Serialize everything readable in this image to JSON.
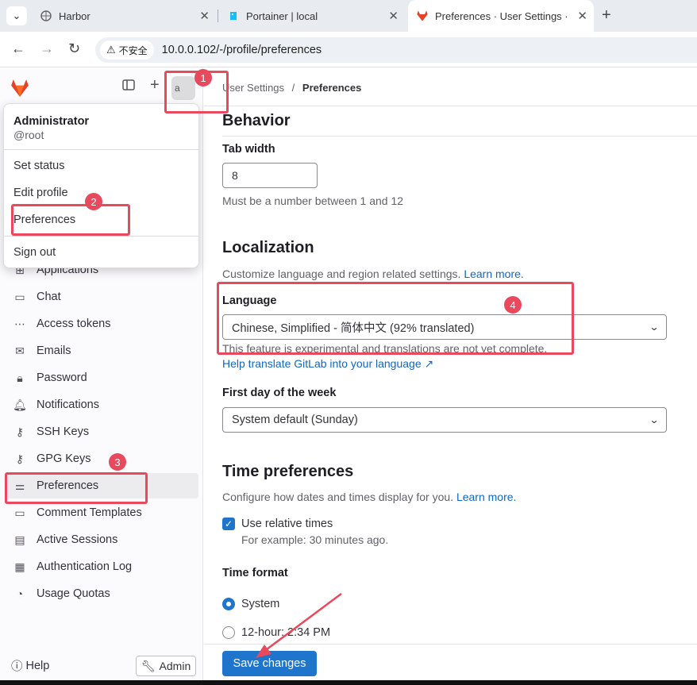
{
  "browser": {
    "tabs": [
      {
        "title": "Harbor"
      },
      {
        "title": "Portainer | local"
      },
      {
        "title": "Preferences · User Settings · "
      }
    ],
    "security_label": "不安全",
    "url": "10.0.0.102/-/profile/preferences"
  },
  "avatar_alt": "a",
  "user_menu": {
    "name": "Administrator",
    "handle": "@root",
    "items": [
      "Set status",
      "Edit profile",
      "Preferences",
      "Sign out"
    ]
  },
  "sidebar": {
    "items": [
      {
        "label": "Applications",
        "icon": "applications-icon"
      },
      {
        "label": "Chat",
        "icon": "chat-icon"
      },
      {
        "label": "Access tokens",
        "icon": "token-icon"
      },
      {
        "label": "Emails",
        "icon": "mail-icon"
      },
      {
        "label": "Password",
        "icon": "lock-icon"
      },
      {
        "label": "Notifications",
        "icon": "bell-icon"
      },
      {
        "label": "SSH Keys",
        "icon": "key-icon"
      },
      {
        "label": "GPG Keys",
        "icon": "key-icon"
      },
      {
        "label": "Preferences",
        "icon": "preferences-icon"
      },
      {
        "label": "Comment Templates",
        "icon": "comment-icon"
      },
      {
        "label": "Active Sessions",
        "icon": "monitor-icon"
      },
      {
        "label": "Authentication Log",
        "icon": "log-icon"
      },
      {
        "label": "Usage Quotas",
        "icon": "quota-icon"
      }
    ],
    "help": "Help",
    "admin": "Admin"
  },
  "breadcrumb": {
    "parent": "User Settings",
    "sep": "/",
    "current": "Preferences"
  },
  "behavior": {
    "title": "Behavior",
    "tab_width_label": "Tab width",
    "tab_width_value": "8",
    "tab_width_help": "Must be a number between 1 and 12"
  },
  "localization": {
    "title": "Localization",
    "desc": "Customize language and region related settings.",
    "learn_more": "Learn more.",
    "language_label": "Language",
    "language_value": "Chinese, Simplified - 简体中文 (92% translated)",
    "experimental_note": "This feature is experimental and translations are not yet complete.",
    "translate_link": "Help translate GitLab into your language",
    "first_day_label": "First day of the week",
    "first_day_value": "System default (Sunday)"
  },
  "time_prefs": {
    "title": "Time preferences",
    "desc": "Configure how dates and times display for you.",
    "learn_more": "Learn more.",
    "relative_label": "Use relative times",
    "relative_example": "For example: 30 minutes ago.",
    "format_label": "Time format",
    "opt_system": "System",
    "opt_12h": "12-hour: 2:34 PM"
  },
  "save_label": "Save changes",
  "annotations": [
    "1",
    "2",
    "3",
    "4"
  ],
  "colors": {
    "accent": "#1f75cb",
    "highlight": "#e8495c",
    "gitlab_orange": "#e24329"
  }
}
